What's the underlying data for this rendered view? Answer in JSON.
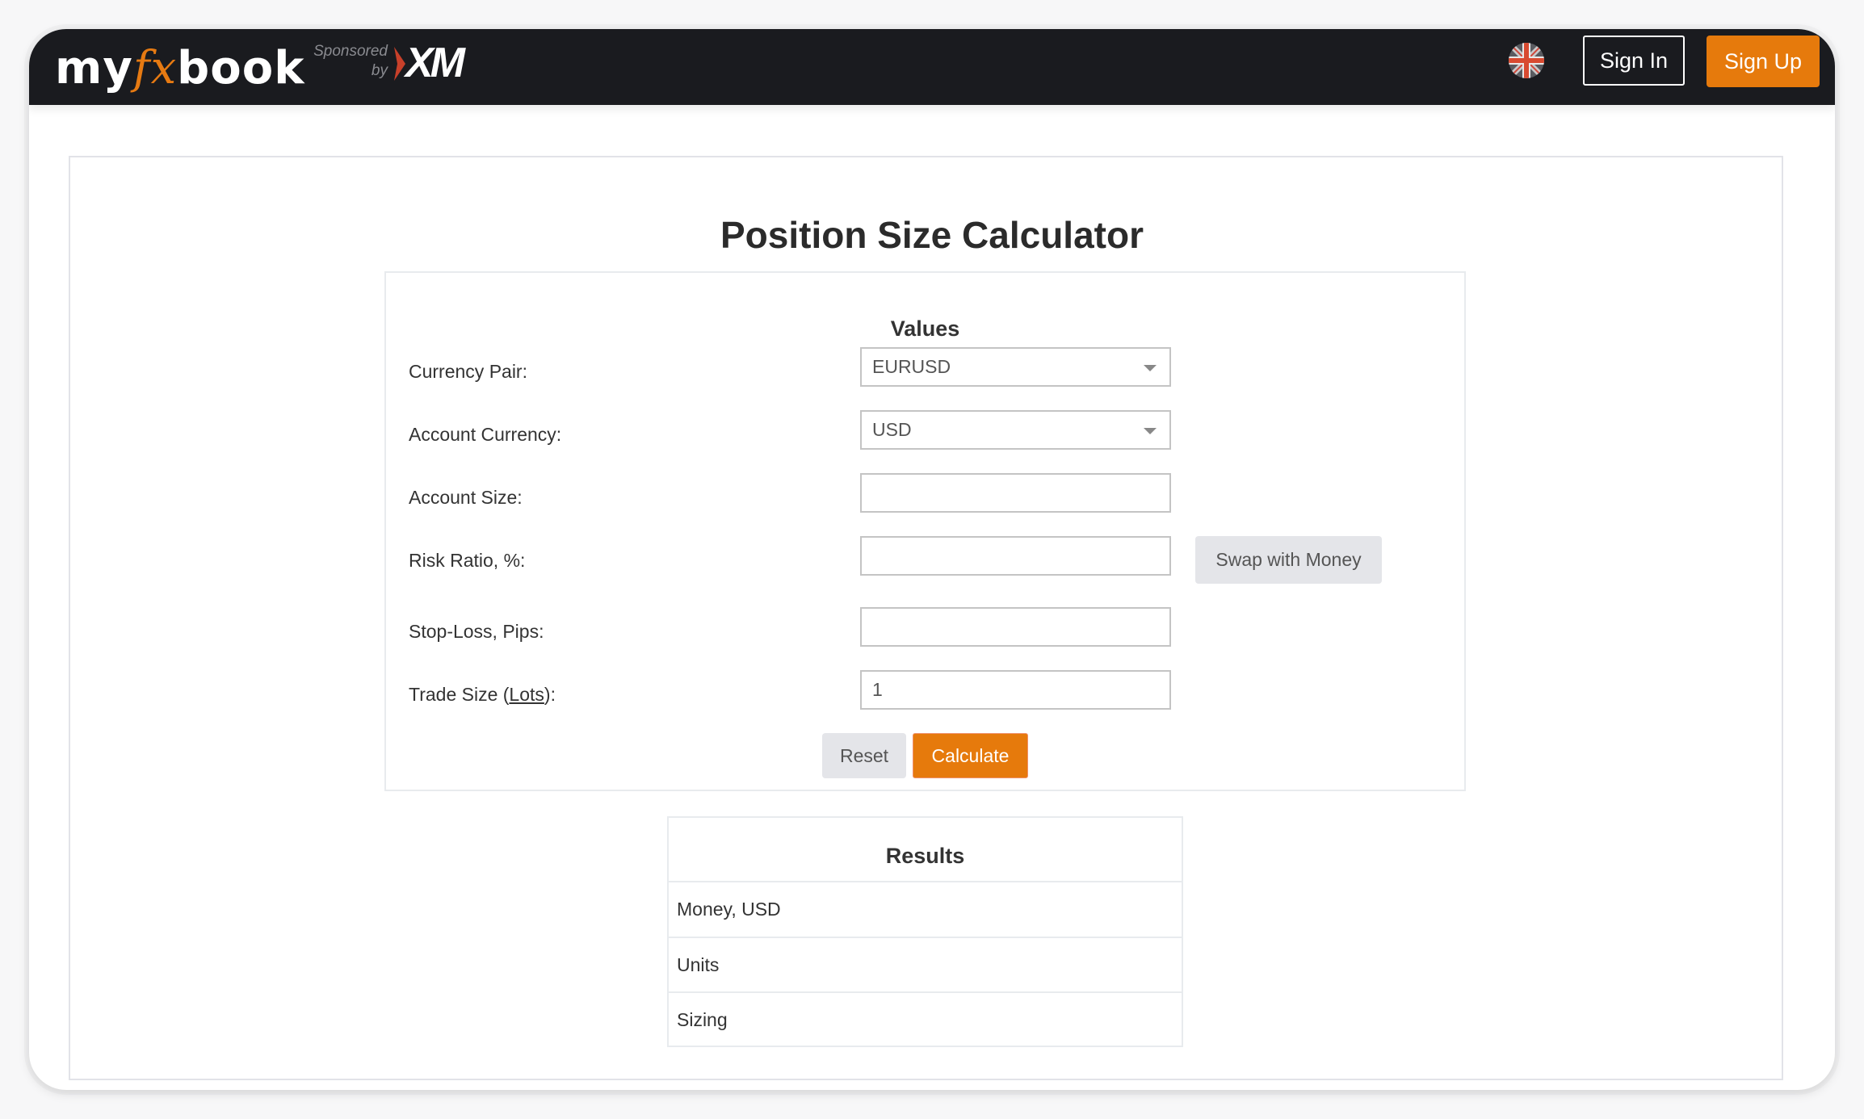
{
  "header": {
    "logo": {
      "pre": "my",
      "fx": "fx",
      "post": "book"
    },
    "sponsored_line1": "Sponsored",
    "sponsored_line2": "by",
    "sponsor_name": "XM",
    "language_icon": "uk-flag-icon",
    "sign_in_label": "Sign In",
    "sign_up_label": "Sign Up"
  },
  "page": {
    "title": "Position Size Calculator"
  },
  "values": {
    "title": "Values",
    "currency_pair": {
      "label": "Currency Pair:",
      "value": "EURUSD"
    },
    "account_currency": {
      "label": "Account Currency:",
      "value": "USD"
    },
    "account_size": {
      "label": "Account Size:",
      "value": ""
    },
    "risk_ratio": {
      "label": "Risk Ratio, %:",
      "value": ""
    },
    "swap_label": "Swap with Money",
    "stop_loss": {
      "label": "Stop-Loss, Pips:",
      "value": ""
    },
    "trade_size": {
      "label_pre": "Trade Size (",
      "label_link": "Lots",
      "label_post": "):",
      "value": "1"
    },
    "reset_label": "Reset",
    "calculate_label": "Calculate"
  },
  "results": {
    "title": "Results",
    "rows": [
      {
        "label": "Money, USD"
      },
      {
        "label": "Units"
      },
      {
        "label": "Sizing"
      }
    ]
  },
  "colors": {
    "accent": "#e67a0c",
    "header_bg": "#1a1b1f"
  }
}
